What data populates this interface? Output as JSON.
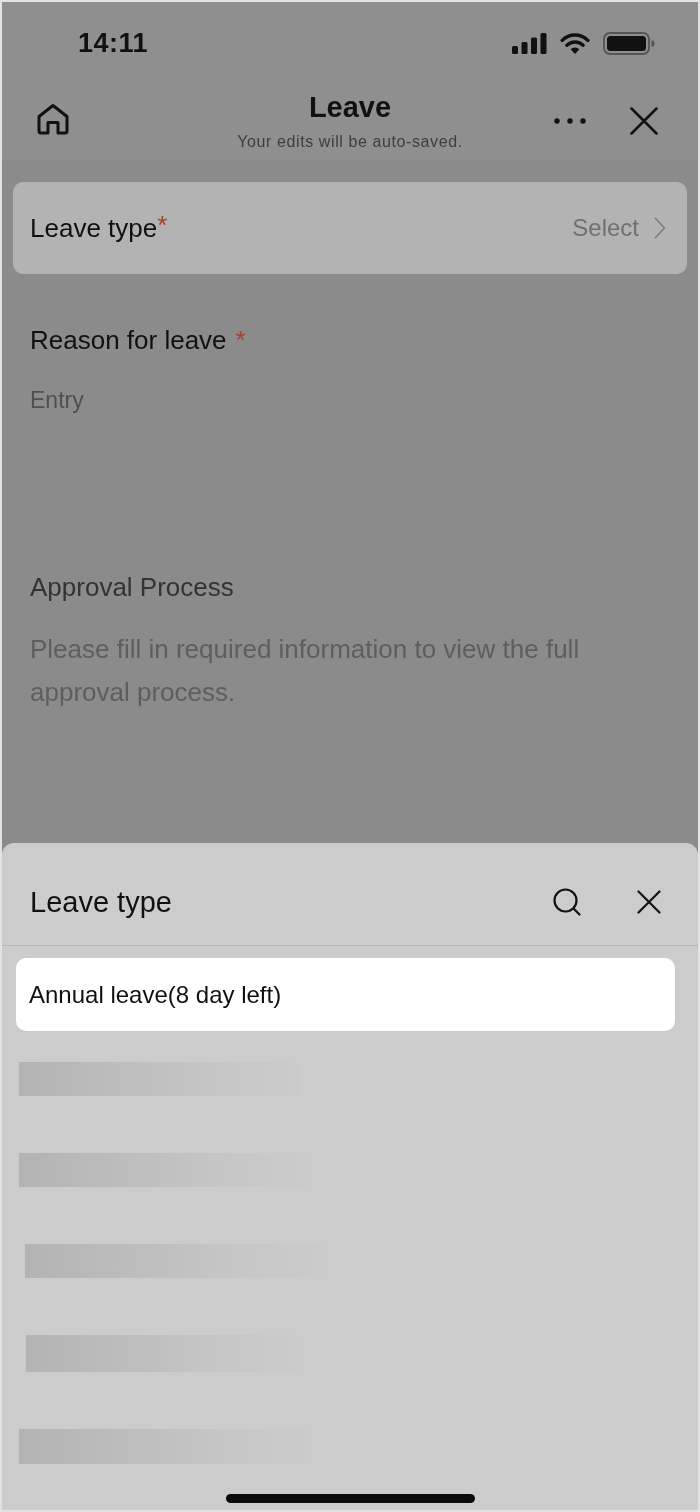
{
  "status_bar": {
    "time": "14:11"
  },
  "header": {
    "title": "Leave",
    "subtitle": "Your edits will be auto-saved."
  },
  "leave_type": {
    "label": "Leave type",
    "required_mark": "*",
    "placeholder": "Select"
  },
  "reason": {
    "label": "Reason for leave",
    "required_mark": "*",
    "placeholder": "Entry"
  },
  "approval": {
    "title": "Approval Process",
    "message": "Please fill in required information to view the full approval process."
  },
  "sheet": {
    "title": "Leave type",
    "options": [
      {
        "label": "Annual leave(8 day left)"
      }
    ],
    "loading_rows": [
      {
        "kind": "skeleton"
      },
      {
        "kind": "skeleton"
      },
      {
        "kind": "skeleton"
      },
      {
        "kind": "skeleton"
      },
      {
        "kind": "skeleton"
      }
    ]
  }
}
